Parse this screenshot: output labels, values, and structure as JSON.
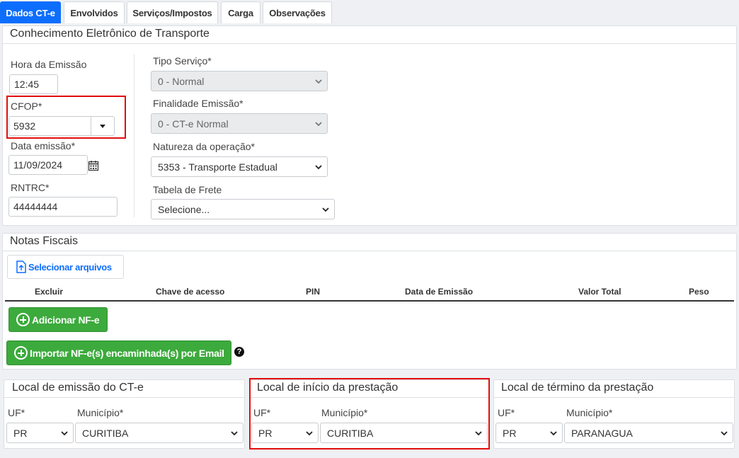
{
  "tabs": [
    {
      "label": "Dados CT-e",
      "active": true
    },
    {
      "label": "Envolvidos"
    },
    {
      "label": "Serviços/Impostos"
    },
    {
      "label": "Carga"
    },
    {
      "label": "Observações"
    }
  ],
  "cte": {
    "title": "Conhecimento Eletrônico de Transporte",
    "hora_label": "Hora da Emissão",
    "hora_value": "12:45",
    "cfop_label": "CFOP*",
    "cfop_value": "5932",
    "data_label": "Data emissão*",
    "data_value": "11/09/2024",
    "rntrc_label": "RNTRC*",
    "rntrc_value": "44444444",
    "tipo_label": "Tipo Serviço*",
    "tipo_value": "0 - Normal",
    "finalidade_label": "Finalidade Emissão*",
    "finalidade_value": "0 - CT-e Normal",
    "natureza_label": "Natureza da operação*",
    "natureza_value": "5353 - Transporte Estadual",
    "tabela_label": "Tabela de Frete",
    "tabela_value": "Selecione..."
  },
  "notas": {
    "title": "Notas Fiscais",
    "select_files": "Selecionar arquivos",
    "columns": [
      "Excluir",
      "Chave de acesso",
      "PIN",
      "Data de Emissão",
      "Valor Total",
      "Peso"
    ],
    "add_button": "Adicionar NF-e",
    "import_button": "Importar NF-e(s) encaminhada(s) por Email"
  },
  "locais": [
    {
      "title": "Local de emissão do CT-e",
      "uf_label": "UF*",
      "mun_label": "Município*",
      "uf": "PR",
      "municipio": "CURITIBA"
    },
    {
      "title": "Local de início da prestação",
      "uf_label": "UF*",
      "mun_label": "Município*",
      "uf": "PR",
      "municipio": "CURITIBA"
    },
    {
      "title": "Local de término da prestação",
      "uf_label": "UF*",
      "mun_label": "Município*",
      "uf": "PR",
      "municipio": "PARANAGUA"
    }
  ],
  "colors": {
    "accent": "#0d6efd",
    "green": "#3caa3c",
    "highlight": "#e20d0d"
  }
}
